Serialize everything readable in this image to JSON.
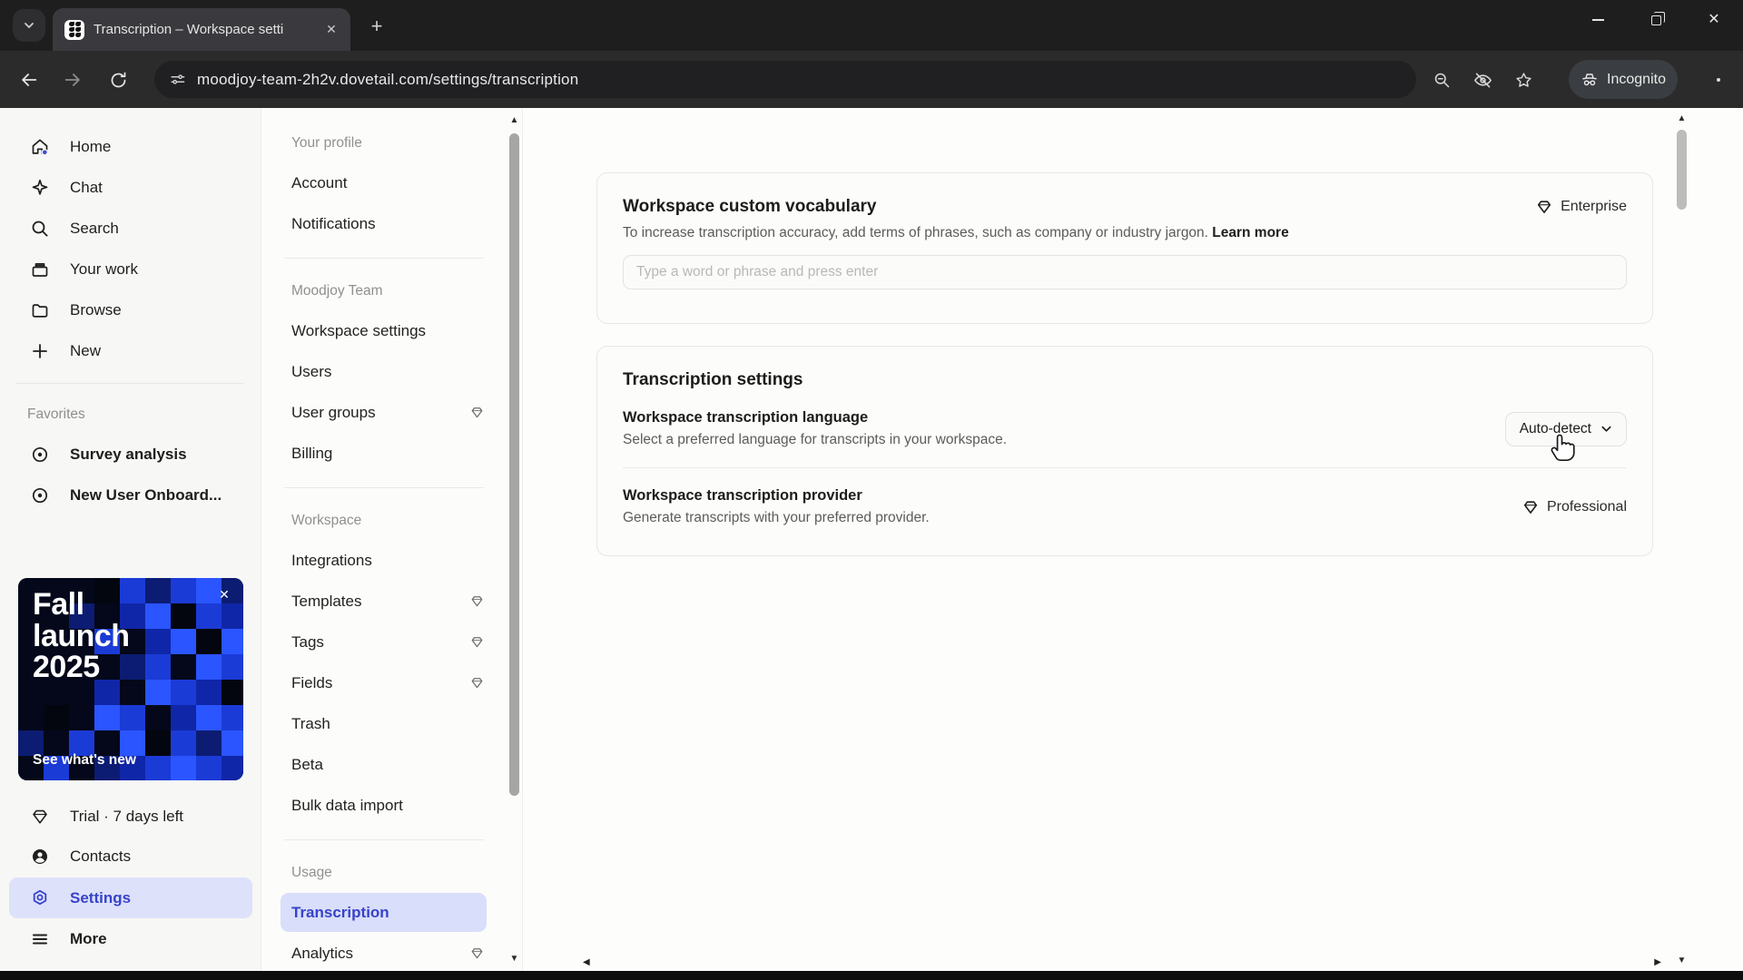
{
  "browser": {
    "tab_title": "Transcription – Workspace setti",
    "url": "moodjoy-team-2h2v.dovetail.com/settings/transcription",
    "incognito_label": "Incognito"
  },
  "sidebar": {
    "nav": [
      {
        "label": "Home"
      },
      {
        "label": "Chat"
      },
      {
        "label": "Search"
      },
      {
        "label": "Your work"
      },
      {
        "label": "Browse"
      },
      {
        "label": "New"
      }
    ],
    "favorites_label": "Favorites",
    "favorites": [
      {
        "label": "Survey analysis"
      },
      {
        "label": "New User Onboard..."
      }
    ],
    "promo": {
      "line1": "Fall",
      "line2": "launch",
      "line3": "2025",
      "cta": "See what's new"
    },
    "footer": [
      {
        "label": "Trial · 7 days left"
      },
      {
        "label": "Contacts"
      },
      {
        "label": "Settings"
      },
      {
        "label": "More"
      }
    ]
  },
  "settings_nav": {
    "sections": [
      {
        "label": "Your profile",
        "items": [
          {
            "label": "Account"
          },
          {
            "label": "Notifications"
          }
        ]
      },
      {
        "label": "Moodjoy Team",
        "items": [
          {
            "label": "Workspace settings"
          },
          {
            "label": "Users"
          },
          {
            "label": "User groups"
          },
          {
            "label": "Billing"
          }
        ]
      },
      {
        "label": "Workspace",
        "items": [
          {
            "label": "Integrations"
          },
          {
            "label": "Templates"
          },
          {
            "label": "Tags"
          },
          {
            "label": "Fields"
          },
          {
            "label": "Trash"
          },
          {
            "label": "Beta"
          },
          {
            "label": "Bulk data import"
          }
        ]
      },
      {
        "label": "Usage",
        "items": [
          {
            "label": "Transcription"
          },
          {
            "label": "Analytics"
          }
        ]
      }
    ]
  },
  "main": {
    "vocabulary": {
      "title": "Workspace custom vocabulary",
      "plan": "Enterprise",
      "description": "To increase transcription accuracy, add terms of phrases, such as company or industry jargon.",
      "learn_more": "Learn more",
      "placeholder": "Type a word or phrase and press enter"
    },
    "transcription": {
      "title": "Transcription settings",
      "language_row": {
        "title": "Workspace transcription language",
        "description": "Select a preferred language for transcripts in your workspace.",
        "value": "Auto-detect"
      },
      "provider_row": {
        "title": "Workspace transcription provider",
        "description": "Generate transcripts with your preferred provider.",
        "plan": "Professional"
      }
    }
  },
  "colors": {
    "accent": "#3743c9",
    "selected_bg": "#d9defa",
    "promo_blue": "#2a55ff"
  }
}
